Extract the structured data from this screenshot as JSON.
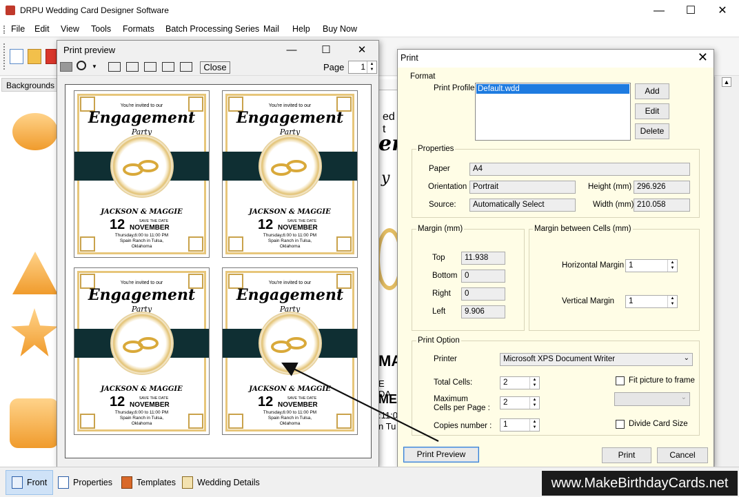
{
  "app": {
    "title": "DRPU Wedding Card Designer Software",
    "controls": {
      "minimize": "—",
      "maximize": "☐",
      "close": "✕"
    }
  },
  "menu": [
    "File",
    "Edit",
    "View",
    "Tools",
    "Formats",
    "Batch Processing Series",
    "Mail",
    "Help",
    "Buy Now"
  ],
  "left_panel": {
    "tab": "Backgrounds"
  },
  "canvas_peek": {
    "line1": "ed t",
    "line2": "en",
    "line3": "y",
    "line4": "MA",
    "line5": "E DA",
    "line6": "ME",
    "line7": ":11:0",
    "line8": "n Tu"
  },
  "print_preview": {
    "title": "Print preview",
    "close_label": "Close",
    "page_label": "Page",
    "page_value": "1",
    "cards": [
      {
        "invite": "You're invited to our",
        "title": "Engagement",
        "subtitle": "Party",
        "names": "JACKSON & MAGGIE",
        "save": "SAVE THE DATE",
        "day": "12",
        "month": "NOVEMBER",
        "time": "Thursday,6:00 to 11:00 PM",
        "place": "Spain Ranch in Tulsa,",
        "state": "Oklahoma"
      },
      {
        "invite": "You're invited to our",
        "title": "Engagement",
        "subtitle": "Party",
        "names": "JACKSON & MAGGIE",
        "save": "SAVE THE DATE",
        "day": "12",
        "month": "NOVEMBER",
        "time": "Thursday,6:00 to 11:00 PM",
        "place": "Spain Ranch in Tulsa,",
        "state": "Oklahoma"
      },
      {
        "invite": "You're invited to our",
        "title": "Engagement",
        "subtitle": "Party",
        "names": "JACKSON & MAGGIE",
        "save": "SAVE THE DATE",
        "day": "12",
        "month": "NOVEMBER",
        "time": "Thursday,6:00 to 11:00 PM",
        "place": "Spain Ranch in Tulsa,",
        "state": "Oklahoma"
      },
      {
        "invite": "You're invited to our",
        "title": "Engagement",
        "subtitle": "Party",
        "names": "JACKSON & MAGGIE",
        "save": "SAVE THE DATE",
        "day": "12",
        "month": "NOVEMBER",
        "time": "Thursday,6:00 to 11:00 PM",
        "place": "Spain Ranch in Tulsa,",
        "state": "Oklahoma"
      }
    ]
  },
  "print_dialog": {
    "title": "Print",
    "format": {
      "label": "Format",
      "profile_label": "Print Profile",
      "profiles": [
        "Default.wdd"
      ],
      "add": "Add",
      "edit": "Edit",
      "delete": "Delete"
    },
    "properties": {
      "label": "Properties",
      "paper_label": "Paper",
      "paper": "A4",
      "orientation_label": "Orientation",
      "orientation": "Portrait",
      "height_label": "Height (mm)",
      "height": "296.926",
      "source_label": "Source:",
      "source": "Automatically Select",
      "width_label": "Width (mm)",
      "width": "210.058"
    },
    "margin": {
      "label": "Margin (mm)",
      "top_label": "Top",
      "top": "11.938",
      "bottom_label": "Bottom",
      "bottom": "0",
      "right_label": "Right",
      "right": "0",
      "left_label": "Left",
      "left": "9.906"
    },
    "cell_margin": {
      "label": "Margin between Cells (mm)",
      "horizontal_label": "Horizontal Margin",
      "horizontal": "1",
      "vertical_label": "Vertical Margin",
      "vertical": "1"
    },
    "print_option": {
      "label": "Print Option",
      "printer_label": "Printer",
      "printer": "Microsoft XPS Document Writer",
      "total_cells_label": "Total Cells:",
      "total_cells": "2",
      "max_cells_label_1": "Maximum",
      "max_cells_label_2": "Cells per Page :",
      "max_cells": "2",
      "copies_label": "Copies number :",
      "copies": "1",
      "fit_label": "Fit picture to frame",
      "divide_label": "Divide Card Size"
    },
    "buttons": {
      "preview": "Print Preview",
      "print": "Print",
      "cancel": "Cancel"
    }
  },
  "status_tabs": [
    "Front",
    "Properties",
    "Templates",
    "Wedding Details"
  ],
  "watermark": "www.MakeBirthdayCards.net"
}
